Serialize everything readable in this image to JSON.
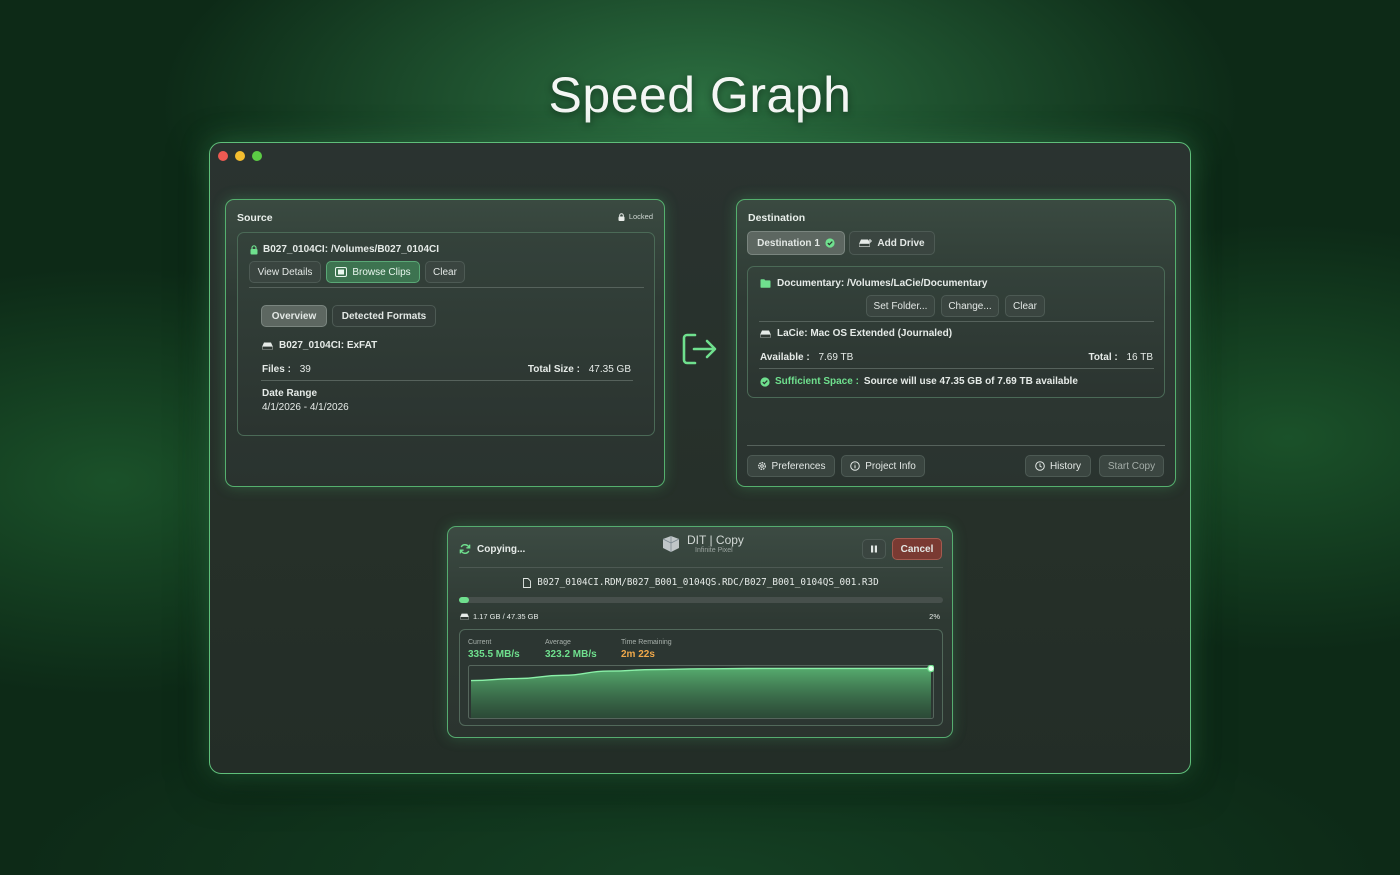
{
  "headline": "Speed Graph",
  "source": {
    "title": "Source",
    "lock_label": "Locked",
    "path_label": "B027_0104CI:  /Volumes/B027_0104CI",
    "buttons": {
      "view_details": "View Details",
      "browse_clips": "Browse Clips",
      "clear": "Clear"
    },
    "tabs": {
      "overview": "Overview",
      "detected_formats": "Detected Formats"
    },
    "drive_label": "B027_0104CI:  ExFAT",
    "files_label": "Files :",
    "files_value": "39",
    "total_size_label": "Total Size :",
    "total_size_value": "47.35 GB",
    "date_range_label": "Date Range",
    "date_range_value": "4/1/2026 - 4/1/2026"
  },
  "destination": {
    "title": "Destination",
    "tab_destination": "Destination 1",
    "add_drive": "Add Drive",
    "path_label": "Documentary:  /Volumes/LaCie/Documentary",
    "buttons": {
      "set_folder": "Set Folder...",
      "change": "Change...",
      "clear": "Clear"
    },
    "drive_label": "LaCie:  Mac OS Extended (Journaled)",
    "available_label": "Available :",
    "available_value": "7.69 TB",
    "total_label": "Total :",
    "total_value": "16 TB",
    "space_label": "Sufficient Space :",
    "space_value": "Source will use 47.35 GB of 7.69 TB available",
    "footer": {
      "preferences": "Preferences",
      "project_info": "Project Info",
      "history": "History",
      "start_copy": "Start Copy"
    }
  },
  "copying": {
    "status": "Copying...",
    "logo_title": "DIT | Copy",
    "logo_subtitle": "Infinite Pixel",
    "cancel": "Cancel",
    "file_path": "B027_0104CI.RDM/B027_B001_0104QS.RDC/B027_B001_0104QS_001.R3D",
    "progress_fraction": 0.02,
    "copied_label": "1.17 GB / 47.35 GB",
    "percent_label": "2%",
    "stats": {
      "current_label": "Current",
      "current_value": "335.5 MB/s",
      "average_label": "Average",
      "average_value": "323.2 MB/s",
      "remaining_label": "Time Remaining",
      "remaining_value": "2m 22s"
    }
  },
  "colors": {
    "accent_green": "#6fe08e",
    "warning_orange": "#f0a84a",
    "cancel_red": "#7a3a32"
  },
  "chart_data": {
    "type": "area",
    "title": "",
    "xlabel": "",
    "ylabel": "",
    "x": [
      0,
      1,
      2,
      3,
      4,
      5,
      6,
      7,
      8,
      9,
      10
    ],
    "values": [
      255,
      268,
      290,
      318,
      328,
      333,
      335,
      335.5,
      335.5,
      335.5,
      335.5
    ],
    "ylim": [
      0,
      345
    ],
    "grid": false
  }
}
